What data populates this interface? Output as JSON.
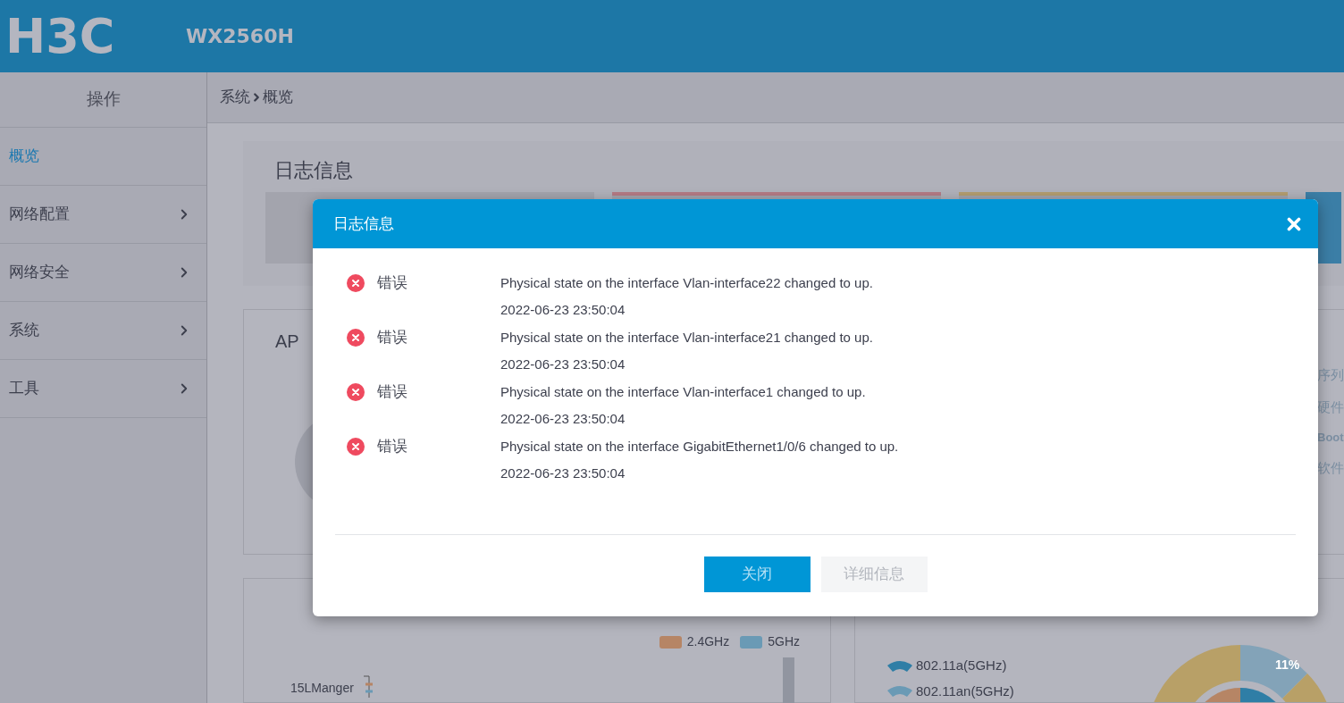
{
  "header": {
    "logo": "H3C",
    "model": "WX2560H"
  },
  "sidebar": {
    "heading": "操作",
    "items": [
      {
        "label": "概览",
        "selected": true,
        "expandable": false
      },
      {
        "label": "网络配置",
        "selected": false,
        "expandable": true
      },
      {
        "label": "网络安全",
        "selected": false,
        "expandable": true
      },
      {
        "label": "系统",
        "selected": false,
        "expandable": true
      },
      {
        "label": "工具",
        "selected": false,
        "expandable": true
      }
    ]
  },
  "breadcrumb": [
    "系统",
    "概览"
  ],
  "log_card": {
    "title": "日志信息"
  },
  "ap_card": {
    "title": "AP"
  },
  "device_card": {
    "labels": [
      "序列",
      "硬件",
      "Boot",
      "软件"
    ]
  },
  "wireless_card": {
    "legend": [
      {
        "label": "2.4GHz",
        "color": "#b68565"
      },
      {
        "label": "5GHz",
        "color": "#6a9ab5"
      }
    ],
    "axis_label": "15LManger"
  },
  "client_card": {
    "legend": [
      {
        "label": "802.11a(5GHz)",
        "color": "#2f7ea6"
      },
      {
        "label": "802.11an(5GHz)",
        "color": "#6a9ab5"
      }
    ],
    "donut_label": "11%"
  },
  "modal": {
    "title": "日志信息",
    "entries": [
      {
        "kind": "error",
        "level": "错误",
        "message": "Physical state on the interface Vlan-interface22 changed to up.",
        "time": "2022-06-23 23:50:04"
      },
      {
        "kind": "error",
        "level": "错误",
        "message": "Physical state on the interface Vlan-interface21 changed to up.",
        "time": "2022-06-23 23:50:04"
      },
      {
        "kind": "error",
        "level": "错误",
        "message": "Physical state on the interface Vlan-interface1 changed to up.",
        "time": "2022-06-23 23:50:04"
      },
      {
        "kind": "error",
        "level": "错误",
        "message": "Physical state on the interface GigabitEthernet1/0/6 changed to up.",
        "time": "2022-06-23 23:50:04"
      }
    ],
    "buttons": [
      {
        "label": "关闭",
        "kind": "primary",
        "disabled": false
      },
      {
        "label": "详细信息",
        "kind": "secondary",
        "disabled": true
      }
    ]
  }
}
